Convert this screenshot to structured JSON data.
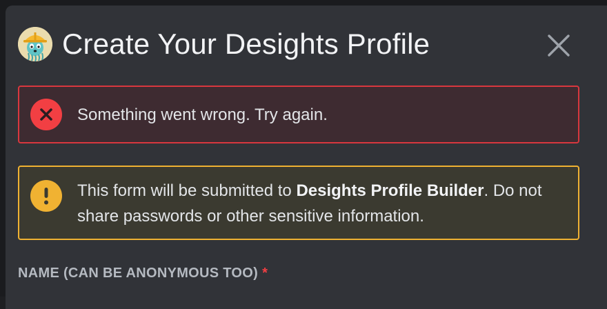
{
  "modal": {
    "title": "Create Your Desights Profile",
    "app_icon": "jellyfish-hardhat-avatar",
    "close_icon": "close-icon"
  },
  "error_banner": {
    "icon": "error-x-icon",
    "text": "Something went wrong. Try again.",
    "color": "#f23f43"
  },
  "warning_banner": {
    "icon": "exclamation-icon",
    "text_before": "This form will be submitted to ",
    "app_name": "Desights Profile Builder",
    "text_after": ". Do not share passwords or other sensitive information.",
    "color": "#f0b232"
  },
  "form": {
    "name_label": "NAME (CAN BE ANONYMOUS TOO)",
    "required_marker": "*"
  }
}
